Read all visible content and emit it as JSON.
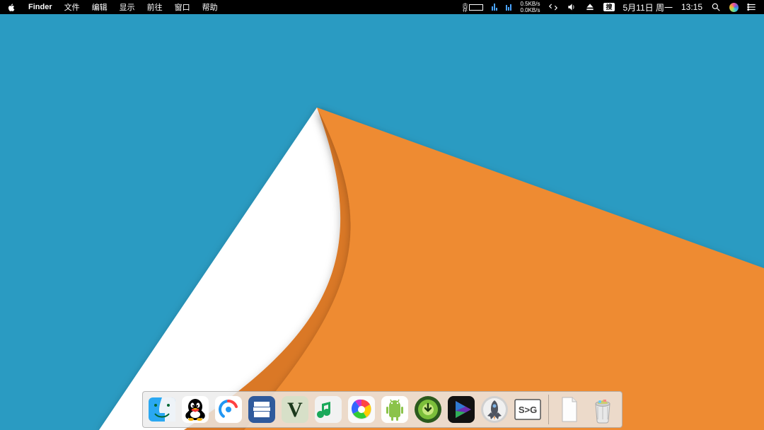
{
  "menubar": {
    "app_name": "Finder",
    "items": [
      "文件",
      "编辑",
      "显示",
      "前往",
      "窗口",
      "帮助"
    ],
    "net_up": "0.5KB/s",
    "net_down": "0.0KB/s",
    "input_method_label": "搜",
    "date": "5月11日 周一",
    "time": "13:15"
  },
  "menubar_icons": {
    "apple": "apple-logo",
    "memory": "memory-indicator",
    "bars": "activity-bars",
    "sync": "sync-icon",
    "volume": "volume-icon",
    "eject": "eject-icon",
    "ime": "input-method-icon",
    "spotlight": "spotlight-icon",
    "siri": "siri-icon",
    "notifications": "notifications-icon"
  },
  "dock": {
    "apps": [
      {
        "name": "finder-app",
        "label": "Finder"
      },
      {
        "name": "qq-app",
        "label": "QQ"
      },
      {
        "name": "baidu-netdisk-app",
        "label": "百度网盘"
      },
      {
        "name": "pdfelement-app",
        "label": "PDFelement"
      },
      {
        "name": "gta-v-app",
        "label": "GTA V"
      },
      {
        "name": "music-app",
        "label": "Music"
      },
      {
        "name": "browser-app",
        "label": "Browser"
      },
      {
        "name": "android-transfer-app",
        "label": "Android"
      },
      {
        "name": "downloader-app",
        "label": "Downloader"
      },
      {
        "name": "media-player-app",
        "label": "Media Player"
      },
      {
        "name": "launchpad-rocket-app",
        "label": "Rocket"
      },
      {
        "name": "screentogif-app",
        "label": "ScreenToGif"
      }
    ],
    "document": {
      "name": "document-item",
      "label": "Document"
    },
    "trash": {
      "name": "trash",
      "label": "Trash"
    }
  }
}
